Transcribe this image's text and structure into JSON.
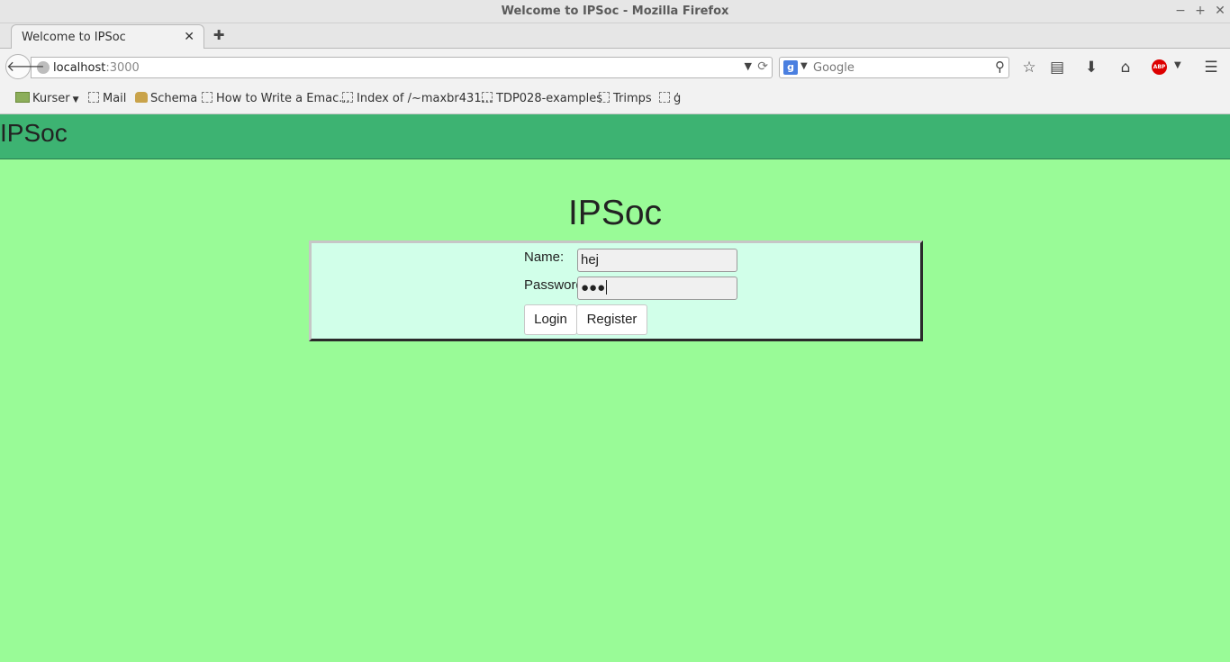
{
  "window": {
    "title": "Welcome to IPSoc - Mozilla Firefox",
    "controls": [
      "−",
      "+",
      "✕"
    ]
  },
  "tab": {
    "label": "Welcome to IPSoc",
    "close": "✕",
    "new": "✚"
  },
  "nav": {
    "url_host": "localhost",
    "url_port": ":3000",
    "search_engine": "g",
    "search_placeholder": "Google"
  },
  "bookmarks": [
    {
      "label": "Kurser",
      "icon": "folder-icon"
    },
    {
      "label": "Mail",
      "icon": "page-icon"
    },
    {
      "label": "Schema",
      "icon": "globe-icon"
    },
    {
      "label": "How to Write a Emac...",
      "icon": "page-icon"
    },
    {
      "label": "Index of /~maxbr431...",
      "icon": "page-icon"
    },
    {
      "label": "TDP028-examples",
      "icon": "page-icon"
    },
    {
      "label": "Trimps",
      "icon": "page-icon"
    },
    {
      "label": "ģ",
      "icon": "page-icon"
    }
  ],
  "app": {
    "brand": "IPSoc",
    "title": "IPSoc",
    "form": {
      "name_label": "Name:",
      "name_value": "hej",
      "password_label": "Password:",
      "password_value": "●●●",
      "login_label": "Login",
      "register_label": "Register"
    }
  },
  "colors": {
    "page_bg": "#99fb97",
    "header_bg": "#3db372",
    "panel_bg": "#d1ffe9"
  }
}
